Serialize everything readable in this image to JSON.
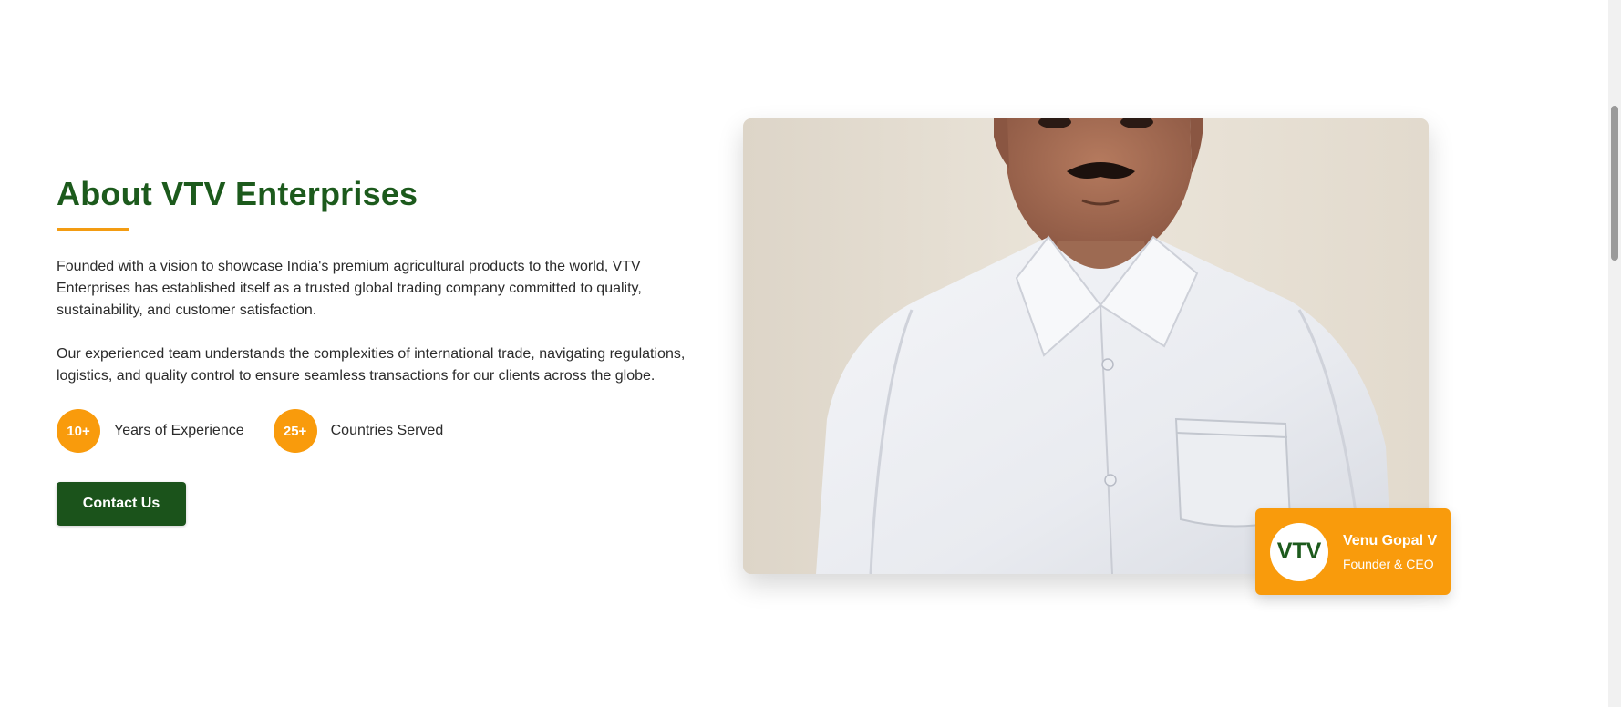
{
  "about": {
    "title": "About VTV Enterprises",
    "paragraphs": [
      "Founded with a vision to showcase India's premium agricultural products to the world, VTV Enterprises has established itself as a trusted global trading company committed to quality, sustainability, and customer satisfaction.",
      "Our experienced team understands the complexities of international trade, navigating regulations, logistics, and quality control to ensure seamless transactions for our clients across the globe."
    ],
    "stats": [
      {
        "value": "10+",
        "label": "Years of Experience"
      },
      {
        "value": "25+",
        "label": "Countries Served"
      }
    ],
    "cta_label": "Contact Us"
  },
  "profile": {
    "logo_text": "VTV",
    "name": "Venu Gopal V",
    "title": "Founder & CEO"
  },
  "colors": {
    "heading_green": "#1c5a1c",
    "accent_orange": "#f99b0c",
    "button_green": "#1b531b"
  }
}
